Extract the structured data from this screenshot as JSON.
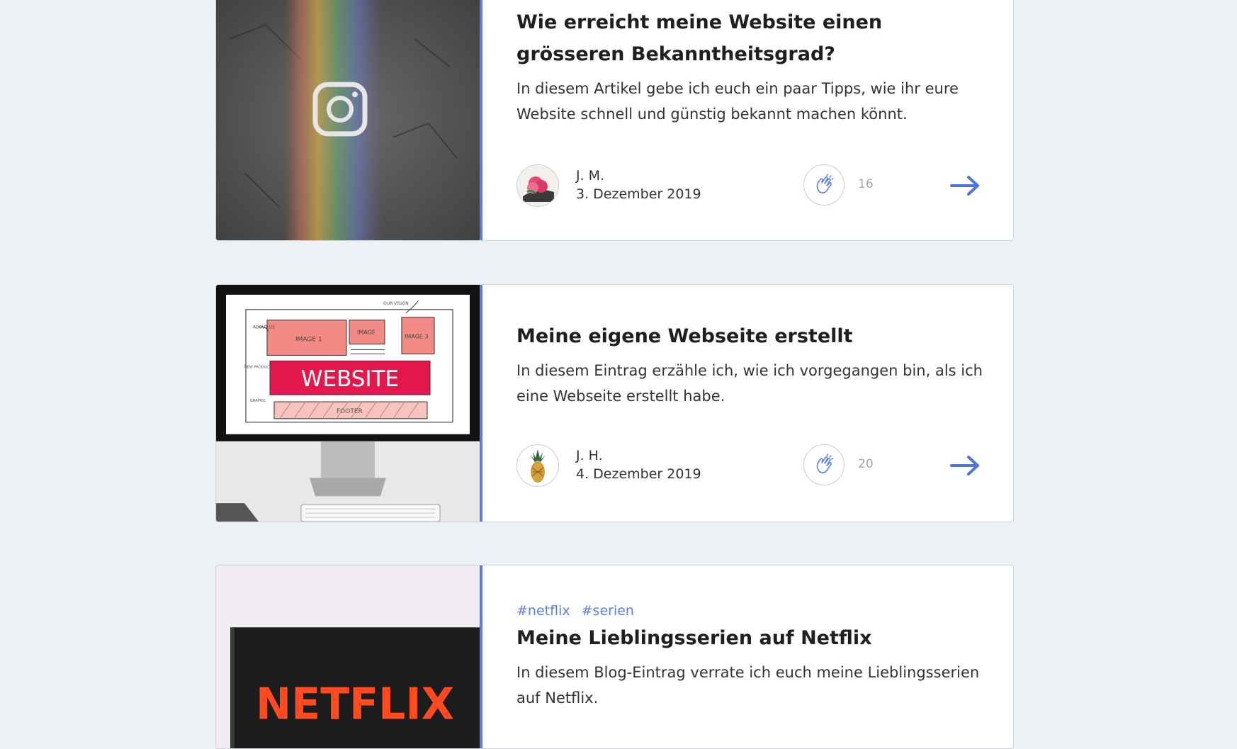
{
  "accent_color": "#5b7ee5",
  "posts": [
    {
      "title": "Wie erreicht meine Website einen grösseren Bekanntheitsgrad?",
      "excerpt": "In diesem Artikel gebe ich euch ein paar Tipps, wie ihr eure Website schnell und günstig bekannt machen könnt.",
      "author": "J. M.",
      "date": "3. Dezember 2019",
      "claps": "16",
      "image": "instagram-rainbow-wall",
      "avatar": "flower-avatar"
    },
    {
      "title": "Meine eigene Webseite erstellt",
      "excerpt": "In diesem Eintrag erzähle ich, wie ich vorgegangen bin, als ich eine Webseite erstellt habe.",
      "author": "J. H.",
      "date": "4. Dezember 2019",
      "claps": "20",
      "image": "website-sketch-monitor",
      "avatar": "pineapple-avatar",
      "image_text": {
        "website": "WEBSITE",
        "image1": "IMAGE 1",
        "image2": "IMAGE",
        "image3": "IMAGE 3",
        "footer": "FOOTER",
        "about": "ABOUT US",
        "vision": "OUR VISION",
        "products": "NEW PRODUCTS",
        "graphic": "GRAPHIC"
      }
    },
    {
      "tags": [
        "#netflix",
        "#serien"
      ],
      "title": "Meine Lieblingsserien auf Netflix",
      "excerpt": "In diesem Blog-Eintrag verrate ich euch meine Lieblingsserien auf Netflix.",
      "image": "netflix-sign",
      "image_text": "NETFLIX"
    }
  ]
}
